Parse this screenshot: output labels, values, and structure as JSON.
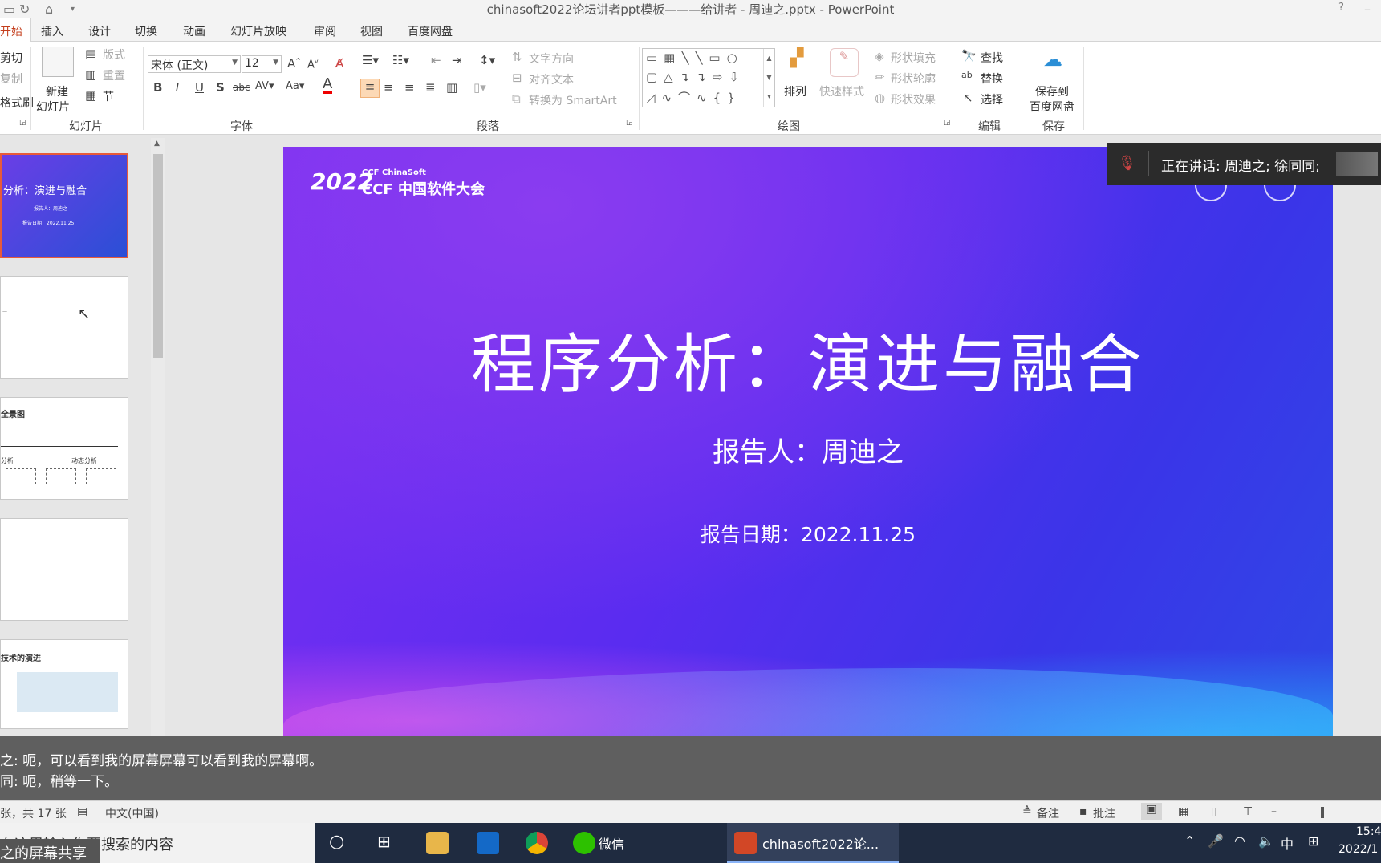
{
  "window_title": "chinasoft2022论坛讲者ppt模板———给讲者 - 周迪之.pptx - PowerPoint",
  "tabs": [
    "开始",
    "插入",
    "设计",
    "切换",
    "动画",
    "幻灯片放映",
    "审阅",
    "视图",
    "百度网盘"
  ],
  "ribbon": {
    "clipboard": {
      "cut_label": "剪切",
      "copy_label": "复制",
      "format_label": "格式刷"
    },
    "slides": {
      "new_slide_label_1": "新建",
      "new_slide_label_2": "幻灯片",
      "layout_label": "版式",
      "reset_label": "重置",
      "section_label": "节",
      "group_label": "幻灯片"
    },
    "font": {
      "font_name": "宋体 (正文)",
      "font_size": "12",
      "group_label": "字体"
    },
    "paragraph": {
      "text_direction": "文字方向",
      "align_text": "对齐文本",
      "smartart": "转换为 SmartArt",
      "group_label": "段落"
    },
    "drawing": {
      "arrange": "排列",
      "quick_styles": "快速样式",
      "shape_fill": "形状填充",
      "shape_outline": "形状轮廓",
      "shape_effects": "形状效果",
      "group_label": "绘图"
    },
    "editing": {
      "find": "查找",
      "replace": "替换",
      "select": "选择",
      "group_label": "编辑"
    },
    "save": {
      "label_1": "保存到",
      "label_2": "百度网盘",
      "group_label": "保存"
    }
  },
  "thumbnails": {
    "t1_title": "分析：演进与融合",
    "t1_sub": "报告人：周迪之",
    "t1_date": "报告日期：2022.11.25",
    "t3_title": "全景图",
    "t3_a": "动态分析",
    "t3_b": "分析",
    "t5_title": "技术的演进"
  },
  "slide": {
    "logo_small": "CCF ChinaSoft",
    "logo_year": "2022",
    "logo_big": "CCF 中国软件大会",
    "title": "程序分析：演进与融合",
    "reporter_label": "报告人：",
    "reporter_name": "周迪之",
    "date": "报告日期：2022.11.25"
  },
  "speaking": "正在讲话: 周迪之; 徐同同;",
  "subtitles": [
    "之: 呃，可以看到我的屏幕屏幕可以看到我的屏幕啊。",
    "同: 呃，稍等一下。"
  ],
  "status": {
    "slide_count": "张，共 17 张",
    "language": "中文(中国)",
    "notes": "备注",
    "comments": "批注"
  },
  "taskbar": {
    "search_placeholder": "在这里输入你要搜索的内容",
    "share_text": "之的屏幕共享",
    "wechat": "微信",
    "ppt_window": "chinasoft2022论...",
    "ime": "中",
    "time": "15:4",
    "date": "2022/1"
  },
  "colors": {
    "accent": "#c43e1c",
    "slide_purple": "#6a2ff0",
    "slide_blue": "#2f48e6"
  }
}
